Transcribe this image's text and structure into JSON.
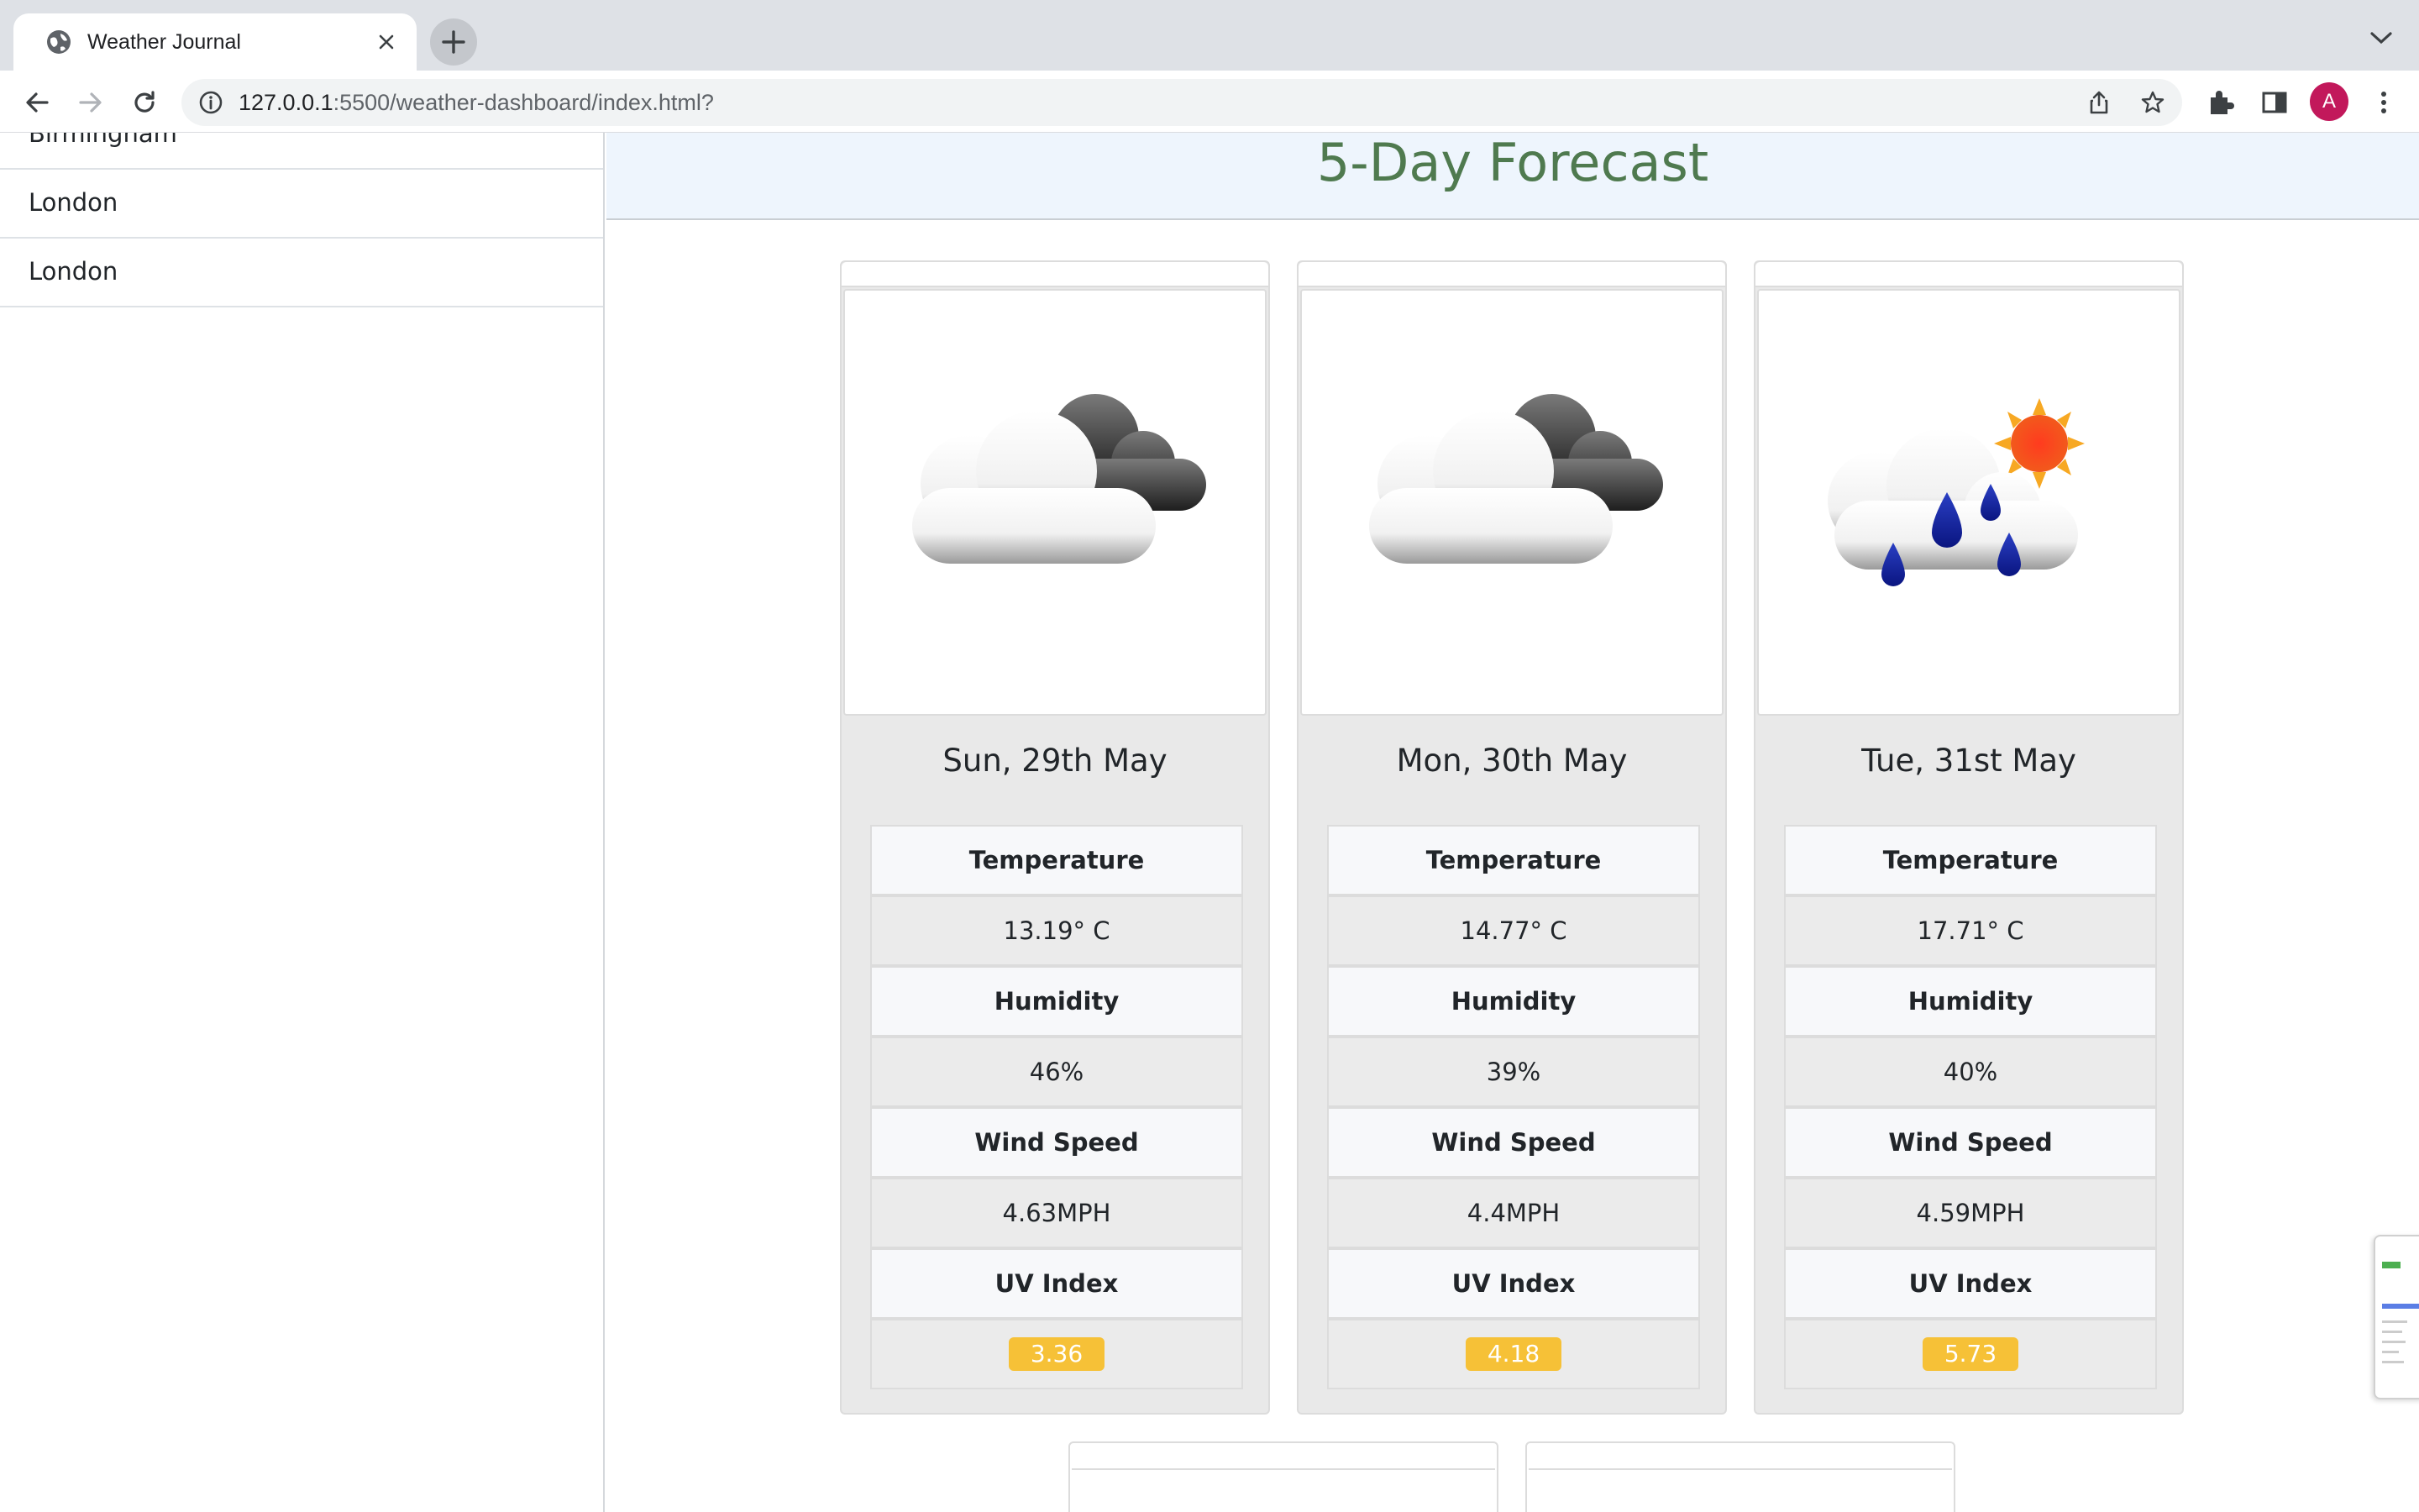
{
  "browser": {
    "tab_title": "Weather Journal",
    "url_host": "127.0.0.1",
    "url_path": ":5500/weather-dashboard/index.html?",
    "profile_initial": "A"
  },
  "sidebar": {
    "history": [
      {
        "label": "Birmingham"
      },
      {
        "label": "London"
      },
      {
        "label": "London"
      }
    ]
  },
  "main": {
    "title": "5-Day Forecast",
    "cards": [
      {
        "icon": "cloudy-icon",
        "date": "Sun, 29th May",
        "temperature_label": "Temperature",
        "temperature": "13.19° C",
        "humidity_label": "Humidity",
        "humidity": "46%",
        "wind_label": "Wind Speed",
        "wind": "4.63MPH",
        "uv_label": "UV Index",
        "uv": "3.36"
      },
      {
        "icon": "cloudy-icon",
        "date": "Mon, 30th May",
        "temperature_label": "Temperature",
        "temperature": "14.77° C",
        "humidity_label": "Humidity",
        "humidity": "39%",
        "wind_label": "Wind Speed",
        "wind": "4.4MPH",
        "uv_label": "UV Index",
        "uv": "4.18"
      },
      {
        "icon": "rain-sun-icon",
        "date": "Tue, 31st May",
        "temperature_label": "Temperature",
        "temperature": "17.71° C",
        "humidity_label": "Humidity",
        "humidity": "40%",
        "wind_label": "Wind Speed",
        "wind": "4.59MPH",
        "uv_label": "UV Index",
        "uv": "5.73"
      }
    ]
  },
  "colors": {
    "title_green": "#4f7a4f",
    "uv_badge": "#f6c137",
    "header_bg": "#eef5fd",
    "avatar": "#c2185b"
  }
}
